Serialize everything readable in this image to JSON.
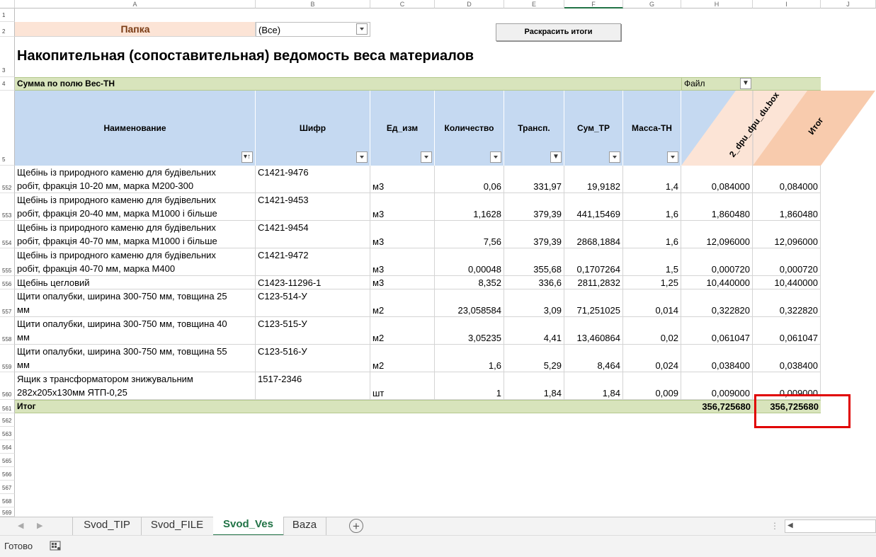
{
  "columns": [
    "A",
    "B",
    "C",
    "D",
    "E",
    "F",
    "G",
    "H",
    "I",
    "J"
  ],
  "filter": {
    "label": "Папка",
    "value": "(Все)"
  },
  "button": {
    "label": "Раскрасить итоги"
  },
  "title": "Накопительная (сопоставительная) ведомость веса материалов",
  "pivot": {
    "sum_label": "Сумма по полю Вес-ТН",
    "file_label": "Файл"
  },
  "headers": [
    "Наименование",
    "Шифр",
    "Ед_изм",
    "Количество",
    "Трансп.",
    "Сум_ТР",
    "Масса-ТН",
    "2_dpu_dpu_du.box",
    "Итог"
  ],
  "rows": [
    {
      "n": "552",
      "name1": "Щебінь із природного каменю для будівельних",
      "name2": "робіт, фракція 10-20 мм, марка М200-300",
      "code": "С1421-9476",
      "unit": "м3",
      "qty": "0,06",
      "tr": "331,97",
      "sum": "19,9182",
      "mass": "1,4",
      "h": "0,084000",
      "i": "0,084000"
    },
    {
      "n": "553",
      "name1": "Щебінь із природного каменю для будівельних",
      "name2": "робіт, фракція 20-40 мм, марка М1000 і більше",
      "code": "С1421-9453",
      "unit": "м3",
      "qty": "1,1628",
      "tr": "379,39",
      "sum": "441,15469",
      "mass": "1,6",
      "h": "1,860480",
      "i": "1,860480"
    },
    {
      "n": "554",
      "name1": "Щебінь із природного каменю для будівельних",
      "name2": "робіт, фракція 40-70 мм, марка М1000 і більше",
      "code": "С1421-9454",
      "unit": "м3",
      "qty": "7,56",
      "tr": "379,39",
      "sum": "2868,1884",
      "mass": "1,6",
      "h": "12,096000",
      "i": "12,096000"
    },
    {
      "n": "555",
      "name1": "Щебінь із природного каменю для будівельних",
      "name2": "робіт, фракція 40-70 мм, марка М400",
      "code": "С1421-9472",
      "unit": "м3",
      "qty": "0,00048",
      "tr": "355,68",
      "sum": "0,1707264",
      "mass": "1,5",
      "h": "0,000720",
      "i": "0,000720"
    },
    {
      "n": "556",
      "name1": "Щебінь цегловий",
      "name2": "",
      "code": "С1423-11296-1",
      "unit": "м3",
      "qty": "8,352",
      "tr": "336,6",
      "sum": "2811,2832",
      "mass": "1,25",
      "h": "10,440000",
      "i": "10,440000"
    },
    {
      "n": "557",
      "name1": "Щити опалубки, ширина 300-750 мм, товщина 25",
      "name2": "мм",
      "code": "С123-514-У",
      "unit": "м2",
      "qty": "23,058584",
      "tr": "3,09",
      "sum": "71,251025",
      "mass": "0,014",
      "h": "0,322820",
      "i": "0,322820"
    },
    {
      "n": "558",
      "name1": "Щити опалубки, ширина 300-750 мм, товщина 40",
      "name2": "мм",
      "code": "С123-515-У",
      "unit": "м2",
      "qty": "3,05235",
      "tr": "4,41",
      "sum": "13,460864",
      "mass": "0,02",
      "h": "0,061047",
      "i": "0,061047"
    },
    {
      "n": "559",
      "name1": "Щити опалубки, ширина 300-750 мм, товщина 55",
      "name2": "мм",
      "code": "С123-516-У",
      "unit": "м2",
      "qty": "1,6",
      "tr": "5,29",
      "sum": "8,464",
      "mass": "0,024",
      "h": "0,038400",
      "i": "0,038400"
    },
    {
      "n": "560",
      "name1": "Ящик з трансформатором знижувальним",
      "name2": "282х205х130мм ЯТП-0,25",
      "code": "1517-2346",
      "unit": "шт",
      "qty": "1",
      "tr": "1,84",
      "sum": "1,84",
      "mass": "0,009",
      "h": "0,009000",
      "i": "0,009000"
    }
  ],
  "total": {
    "n": "561",
    "label": "Итог",
    "h": "356,725680",
    "i": "356,725680"
  },
  "empty_rows": [
    "562",
    "563",
    "564",
    "565",
    "566",
    "567",
    "568",
    "569"
  ],
  "top_rows": [
    "1",
    "2",
    "3",
    "4",
    "5"
  ],
  "tabs": [
    "Svod_TIP",
    "Svod_FILE",
    "Svod_Ves",
    "Baza"
  ],
  "active_tab": "Svod_Ves",
  "status": "Готово",
  "colors": {
    "header_blue": "#c5d9f1",
    "pivot_green": "#d8e4bc",
    "peach": "#fce4d6",
    "orange": "#f8cbad",
    "highlight": "#e00000",
    "tab_green": "#217346"
  }
}
